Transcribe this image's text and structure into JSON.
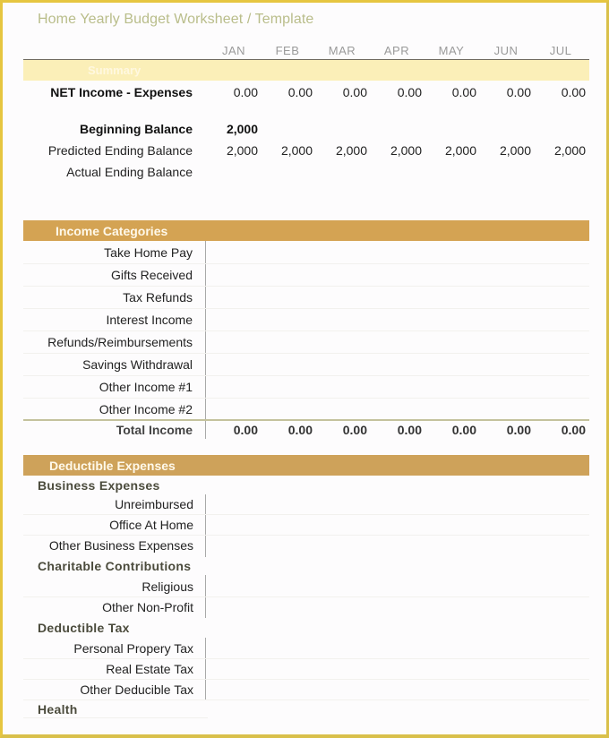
{
  "title": "Home Yearly Budget Worksheet / Template",
  "months": [
    "JAN",
    "FEB",
    "MAR",
    "APR",
    "MAY",
    "JUN",
    "JUL"
  ],
  "summary": {
    "label": "Summary",
    "net_income": {
      "label": "NET Income - Expenses",
      "values": [
        "0.00",
        "0.00",
        "0.00",
        "0.00",
        "0.00",
        "0.00",
        "0.00"
      ]
    },
    "beginning_balance": {
      "label": "Beginning Balance",
      "value": "2,000"
    },
    "predicted_ending": {
      "label": "Predicted Ending Balance",
      "values": [
        "2,000",
        "2,000",
        "2,000",
        "2,000",
        "2,000",
        "2,000",
        "2,000"
      ]
    },
    "actual_ending": {
      "label": "Actual Ending Balance"
    }
  },
  "income": {
    "header": "Income Categories",
    "rows": [
      "Take Home Pay",
      "Gifts Received",
      "Tax Refunds",
      "Interest Income",
      "Refunds/Reimbursements",
      "Savings Withdrawal",
      "Other Income #1",
      "Other Income #2"
    ],
    "total": {
      "label": "Total Income",
      "values": [
        "0.00",
        "0.00",
        "0.00",
        "0.00",
        "0.00",
        "0.00",
        "0.00"
      ]
    }
  },
  "deductible": {
    "header": "Deductible Expenses",
    "groups": [
      {
        "label": "Business Expenses",
        "rows": [
          "Unreimbursed",
          "Office At Home",
          "Other Business Expenses"
        ]
      },
      {
        "label": "Charitable Contributions",
        "rows": [
          "Religious",
          "Other Non-Profit"
        ]
      },
      {
        "label": "Deductible Tax",
        "rows": [
          "Personal Propery Tax",
          "Real Estate Tax",
          "Other Deducible Tax"
        ]
      },
      {
        "label": "Health",
        "rows": []
      }
    ]
  }
}
